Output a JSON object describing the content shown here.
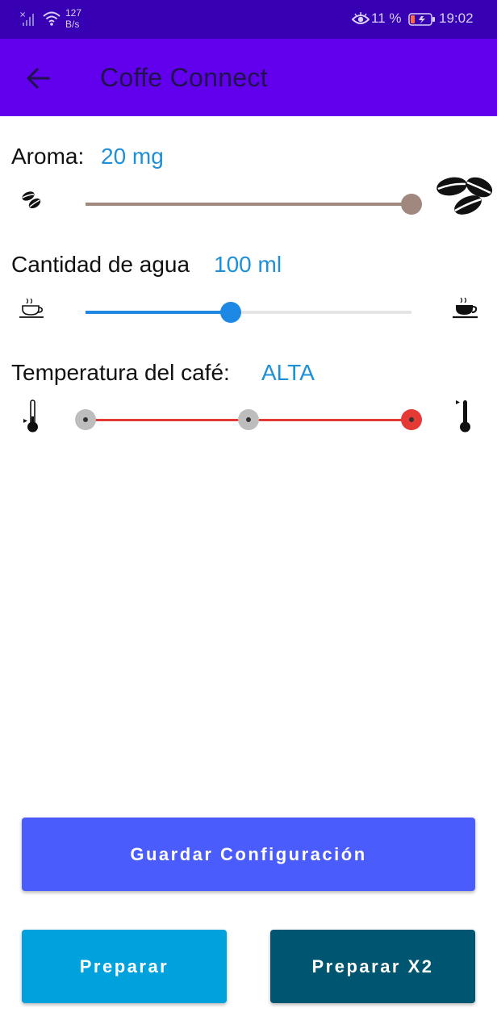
{
  "status_bar": {
    "net_speed_value": "127",
    "net_speed_unit": "B/s",
    "battery_percent": "11 %",
    "time": "19:02",
    "icons": [
      "signal-icon",
      "wifi-icon",
      "eye-icon",
      "battery-icon"
    ]
  },
  "app_bar": {
    "title": "Coffe Connect",
    "back_icon": "arrow-left-icon"
  },
  "aroma": {
    "label": "Aroma:",
    "value": "20 mg",
    "slider_fraction": 1.0,
    "min_icon": "coffee-beans-small-icon",
    "max_icon": "coffee-beans-large-icon"
  },
  "water": {
    "label": "Cantidad de agua",
    "value": "100 ml",
    "slider_fraction": 0.445,
    "min_icon": "coffee-cup-outline-icon",
    "max_icon": "coffee-cup-filled-icon"
  },
  "temperature": {
    "label": "Temperatura del café:",
    "value": "ALTA",
    "levels": 3,
    "selected_level": 3,
    "min_icon": "thermometer-low-icon",
    "max_icon": "thermometer-high-icon"
  },
  "buttons": {
    "save": "Guardar Configuración",
    "prepare": "Preparar",
    "prepare_x2": "Preparar X2"
  },
  "colors": {
    "status_bar": "#3700b3",
    "app_bar": "#6200ee",
    "value_text": "#1e90d8",
    "aroma_slider": "#a1887f",
    "water_slider": "#1e88e5",
    "temperature_slider": "#e53935",
    "save_button": "#4a5cfc",
    "prepare_button": "#00a2dd",
    "prepare_x2_button": "#005670"
  }
}
